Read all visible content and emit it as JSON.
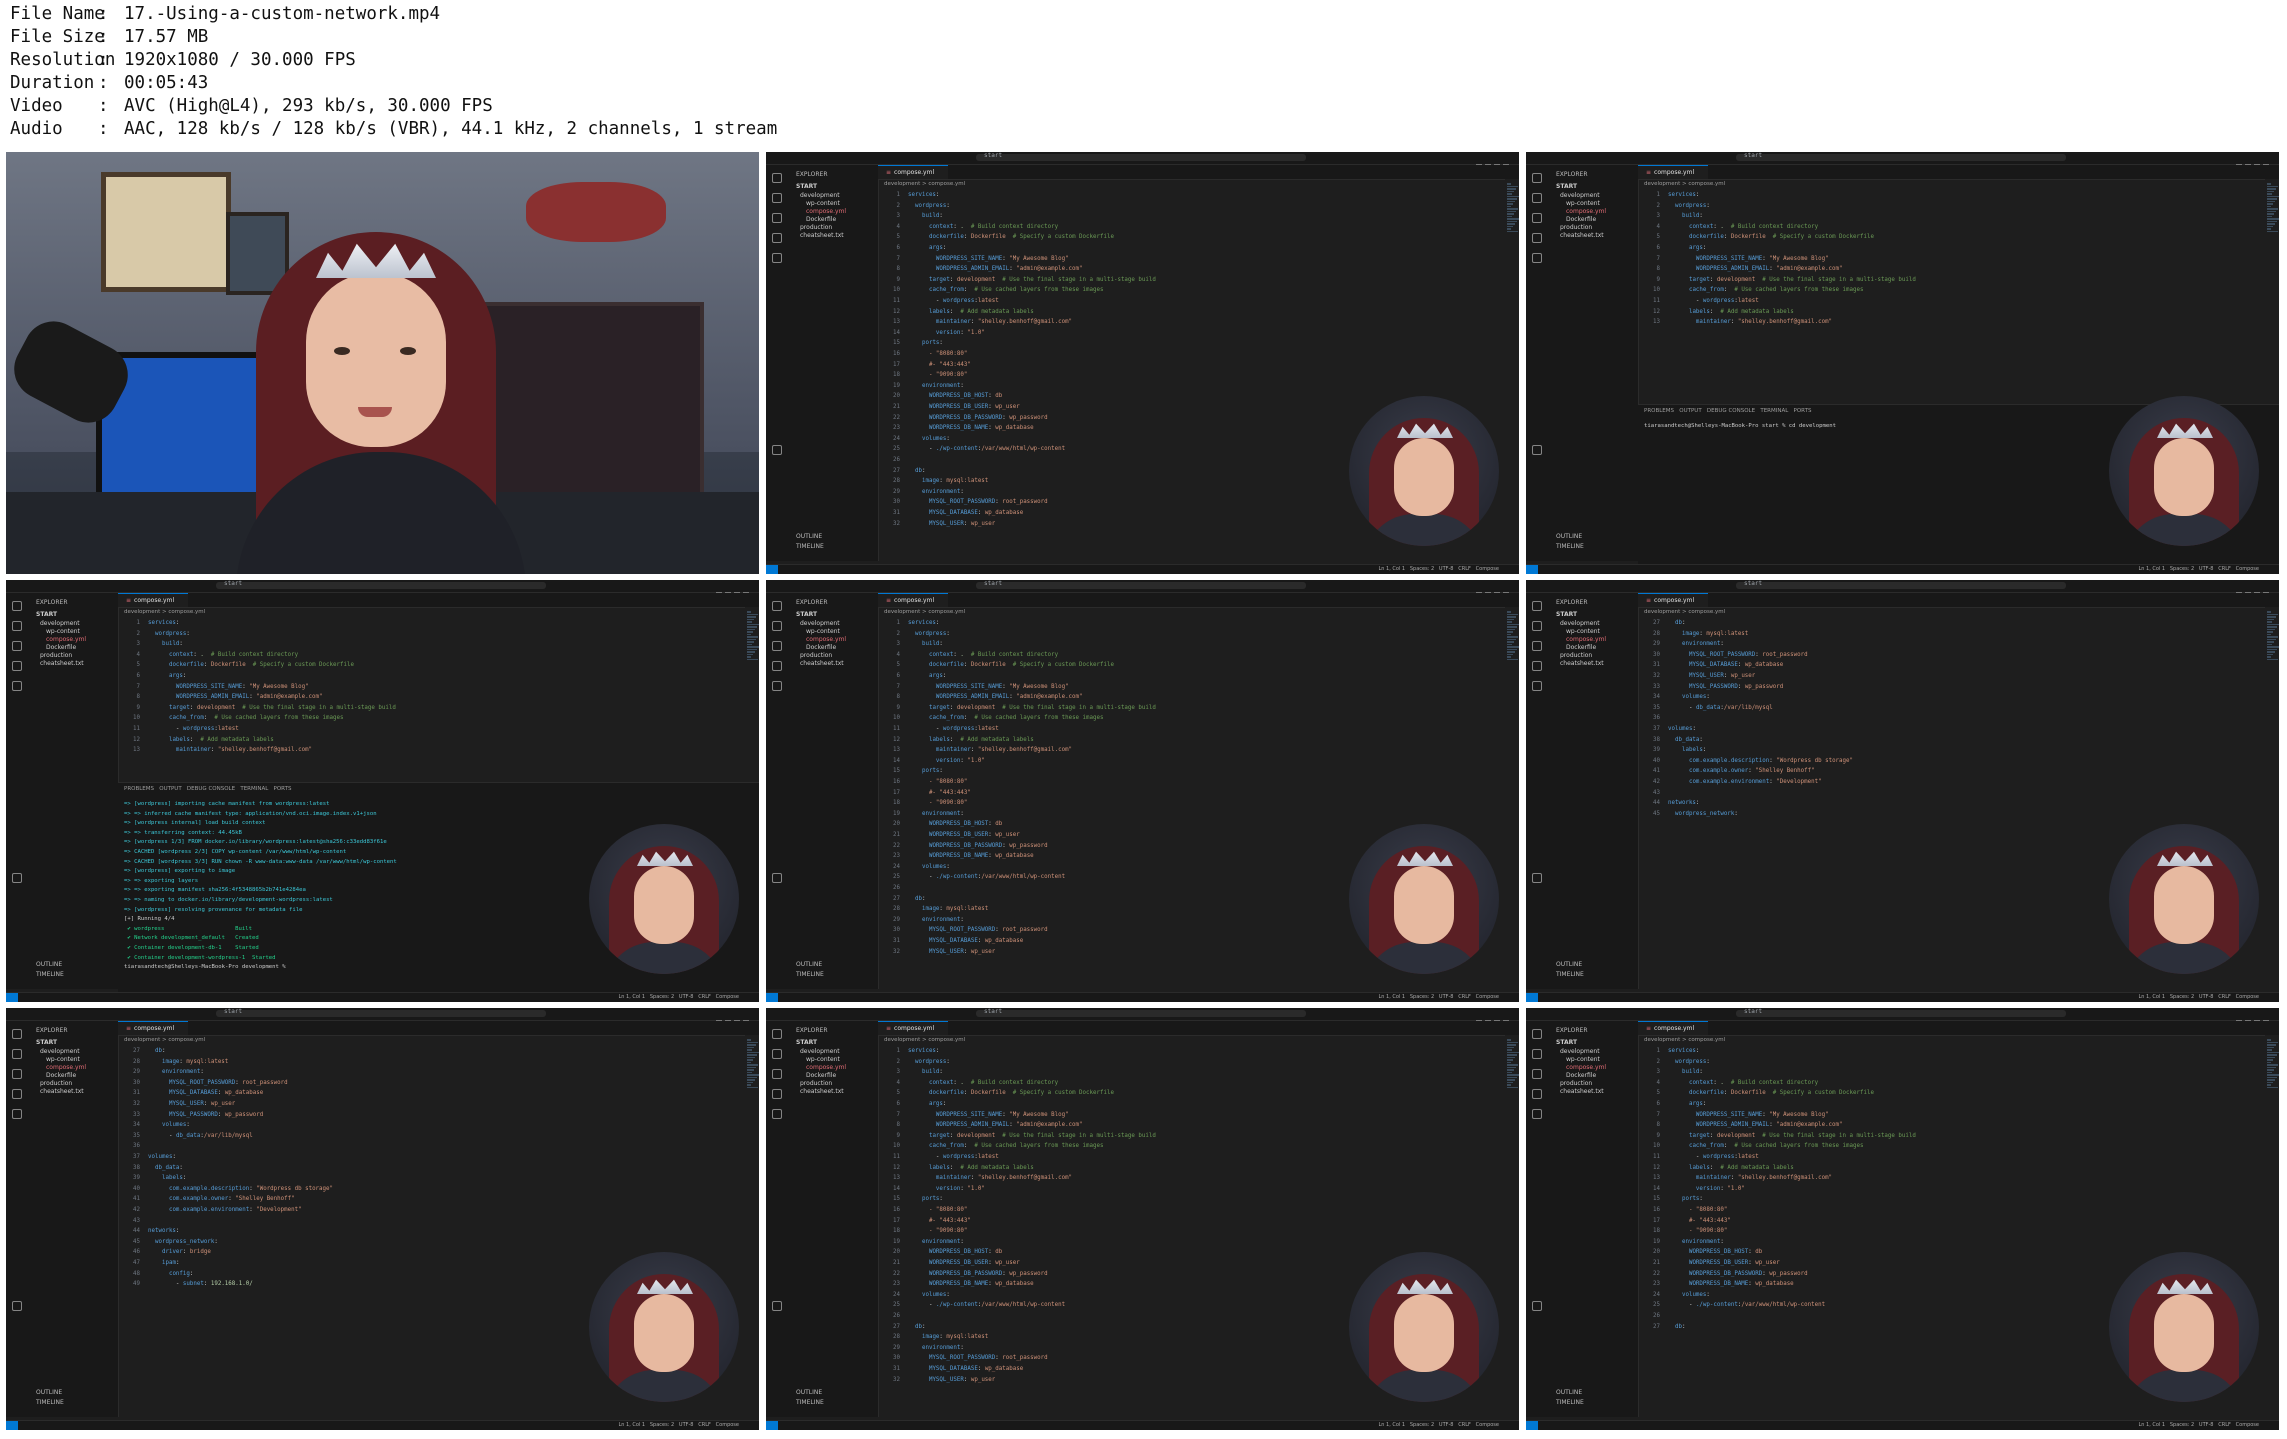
{
  "file_info": [
    {
      "key": "File Name",
      "value": "17.-Using-a-custom-network.mp4"
    },
    {
      "key": "File Size",
      "value": "17.57 MB"
    },
    {
      "key": "Resolution",
      "value": "1920x1080 / 30.000 FPS"
    },
    {
      "key": "Duration",
      "value": "00:05:43"
    },
    {
      "key": "Video",
      "value": "AVC (High@L4), 293 kb/s, 30.000 FPS"
    },
    {
      "key": "Audio",
      "value": "AAC, 128 kb/s / 128 kb/s (VBR), 44.1 kHz, 2 channels, 1 stream"
    }
  ],
  "vscode": {
    "search": "start",
    "explorer_title": "EXPLORER",
    "workspace": "START",
    "files": [
      "development",
      "wp-content",
      "compose.yml",
      "Dockerfile",
      "production",
      "cheatsheet.txt"
    ],
    "outline": "OUTLINE",
    "timeline": "TIMELINE",
    "tab": "compose.yml",
    "breadcrumb": "development > compose.yml",
    "status": "Ln 1, Col 1   Spaces: 2   UTF-8   CRLF   Compose",
    "panel_tabs": "PROBLEMS   OUTPUT   DEBUG CONSOLE   TERMINAL   PORTS",
    "prompt": "tiarasandtech@Shelleys-MacBook-Pro start % cd development",
    "prompt2": "tiarasandtech@Shelleys-MacBook-Pro development %",
    "code_main": [
      "services:",
      "  wordpress:",
      "    build:",
      "      context: .  # Build context directory",
      "      dockerfile: Dockerfile  # Specify a custom Dockerfile",
      "      args:",
      "        WORDPRESS_SITE_NAME: \"My Awesome Blog\"",
      "        WORDPRESS_ADMIN_EMAIL: \"admin@example.com\"",
      "      target: development  # Use the final stage in a multi-stage build",
      "      cache_from:  # Use cached layers from these images",
      "        - wordpress:latest",
      "      labels:  # Add metadata labels",
      "        maintainer: \"shelley.benhoff@gmail.com\"",
      "        version: \"1.0\"",
      "    ports:",
      "      - \"8080:80\"",
      "      #- \"443:443\"",
      "      - \"9090:80\"",
      "    environment:",
      "      WORDPRESS_DB_HOST: db",
      "      WORDPRESS_DB_USER: wp_user",
      "      WORDPRESS_DB_PASSWORD: wp_password",
      "      WORDPRESS_DB_NAME: wp_database",
      "    volumes:",
      "      - ./wp-content:/var/www/html/wp-content",
      "",
      "  db:",
      "    image: mysql:latest",
      "    environment:",
      "      MYSQL_ROOT_PASSWORD: root_password",
      "      MYSQL_DATABASE: wp_database",
      "      MYSQL_USER: wp_user"
    ],
    "code_db": [
      "  db:",
      "    image: mysql:latest",
      "    environment:",
      "      MYSQL_ROOT_PASSWORD: root_password",
      "      MYSQL_DATABASE: wp_database",
      "      MYSQL_USER: wp_user",
      "      MYSQL_PASSWORD: wp_password",
      "    volumes:",
      "      - db_data:/var/lib/mysql",
      "",
      "volumes:",
      "  db_data:",
      "    labels:",
      "      com.example.description: \"Wordpress db storage\"",
      "      com.example.owner: \"Shelley Benhoff\"",
      "      com.example.environment: \"Development\"",
      "",
      "networks:",
      "  wordpress_network:",
      "    driver: bridge",
      "    ipam:",
      "      config:",
      "        - subnet: 192.168.1.0/"
    ],
    "terminal_lines": [
      "=> [wordpress] importing cache manifest from wordpress:latest",
      "=> => inferred cache manifest type: application/vnd.oci.image.index.v1+json",
      "=> [wordpress internal] load build context",
      "=> => transferring context: 44.45kB",
      "=> [wordpress 1/3] FROM docker.io/library/wordpress:latest@sha256:c33edd83f61e",
      "=> CACHED [wordpress 2/3] COPY wp-content /var/www/html/wp-content",
      "=> CACHED [wordpress 3/3] RUN chown -R www-data:www-data /var/www/html/wp-content",
      "=> [wordpress] exporting to image",
      "=> => exporting layers",
      "=> => exporting manifest sha256:4f5348865b2b741e4284ea",
      "=> => naming to docker.io/library/development-wordpress:latest",
      "=> [wordpress] resolving provenance for metadata file",
      "[+] Running 4/4",
      " ✔ wordpress                     Built",
      " ✔ Network development_default   Created",
      " ✔ Container development-db-1    Started",
      " ✔ Container development-wordpress-1  Started"
    ]
  }
}
